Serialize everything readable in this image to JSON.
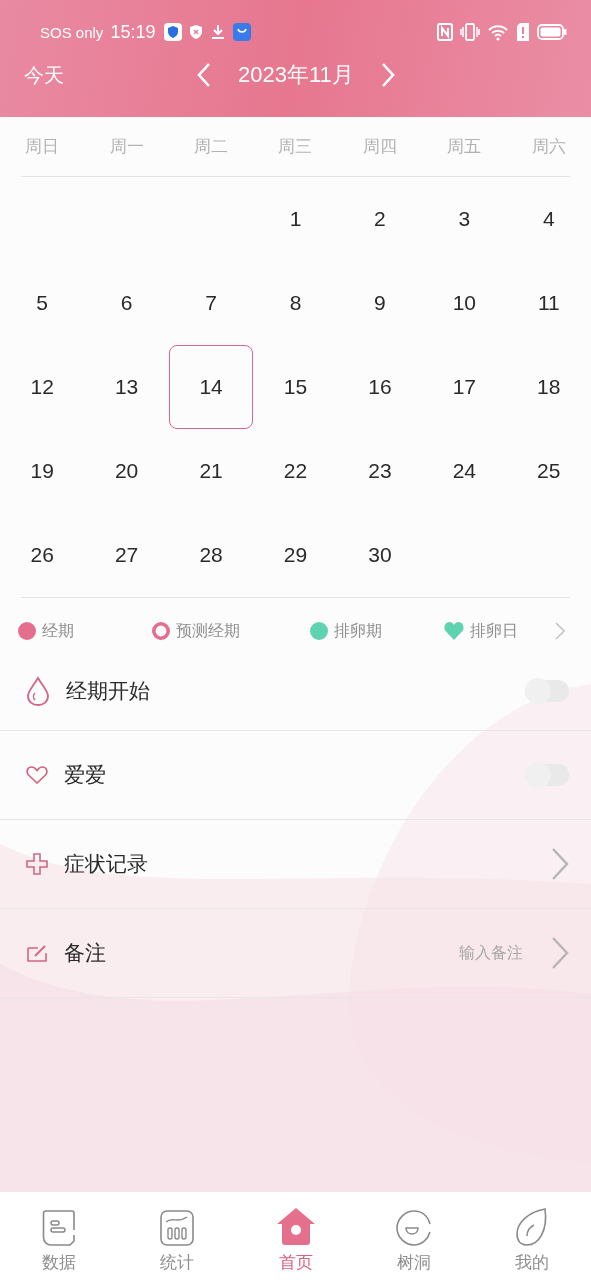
{
  "status_bar": {
    "carrier": "SOS only",
    "time": "15:19"
  },
  "header": {
    "today": "今天",
    "month": "2023年11月"
  },
  "weekdays": [
    "周日",
    "周一",
    "周二",
    "周三",
    "周四",
    "周五",
    "周六"
  ],
  "weeks": [
    [
      {
        "kind": "blank"
      },
      {
        "kind": "blank"
      },
      {
        "kind": "blank"
      },
      {
        "kind": "day",
        "day": "1",
        "selected": false
      },
      {
        "kind": "day",
        "day": "2",
        "selected": false
      },
      {
        "kind": "day",
        "day": "3",
        "selected": false
      },
      {
        "kind": "day",
        "day": "4",
        "selected": false
      }
    ],
    [
      {
        "kind": "day",
        "day": "5",
        "selected": false
      },
      {
        "kind": "day",
        "day": "6",
        "selected": false
      },
      {
        "kind": "day",
        "day": "7",
        "selected": false
      },
      {
        "kind": "day",
        "day": "8",
        "selected": false
      },
      {
        "kind": "day",
        "day": "9",
        "selected": false
      },
      {
        "kind": "day",
        "day": "10",
        "selected": false
      },
      {
        "kind": "day",
        "day": "11",
        "selected": false
      }
    ],
    [
      {
        "kind": "day",
        "day": "12",
        "selected": false
      },
      {
        "kind": "day",
        "day": "13",
        "selected": false
      },
      {
        "kind": "day",
        "day": "14",
        "selected": true
      },
      {
        "kind": "day",
        "day": "15",
        "selected": false
      },
      {
        "kind": "day",
        "day": "16",
        "selected": false
      },
      {
        "kind": "day",
        "day": "17",
        "selected": false
      },
      {
        "kind": "day",
        "day": "18",
        "selected": false
      }
    ],
    [
      {
        "kind": "day",
        "day": "19",
        "selected": false
      },
      {
        "kind": "day",
        "day": "20",
        "selected": false
      },
      {
        "kind": "day",
        "day": "21",
        "selected": false
      },
      {
        "kind": "day",
        "day": "22",
        "selected": false
      },
      {
        "kind": "day",
        "day": "23",
        "selected": false
      },
      {
        "kind": "day",
        "day": "24",
        "selected": false
      },
      {
        "kind": "day",
        "day": "25",
        "selected": false
      }
    ],
    [
      {
        "kind": "day",
        "day": "26",
        "selected": false
      },
      {
        "kind": "day",
        "day": "27",
        "selected": false
      },
      {
        "kind": "day",
        "day": "28",
        "selected": false
      },
      {
        "kind": "day",
        "day": "29",
        "selected": false
      },
      {
        "kind": "day",
        "day": "30",
        "selected": false
      },
      {
        "kind": "blank"
      },
      {
        "kind": "blank"
      }
    ]
  ],
  "legend": [
    {
      "kind": "dot",
      "label": "经期",
      "color": "#e36f8d"
    },
    {
      "kind": "ring",
      "label": "预测经期",
      "color": "#e36f8d"
    },
    {
      "kind": "dot",
      "label": "排卵期",
      "color": "#5fd3b0"
    },
    {
      "kind": "heart",
      "label": "排卵日",
      "color": "#5fd3b0"
    }
  ],
  "records": [
    {
      "kind": "toggle",
      "label": "经期开始",
      "on": false
    },
    {
      "kind": "toggle",
      "label": "爱爱",
      "on": false
    },
    {
      "kind": "link",
      "label": "症状记录"
    },
    {
      "kind": "link",
      "label": "备注",
      "placeholder": "输入备注"
    }
  ],
  "nav": [
    {
      "label": "数据",
      "selected": false
    },
    {
      "label": "统计",
      "selected": false
    },
    {
      "label": "首页",
      "selected": true
    },
    {
      "label": "树洞",
      "selected": false
    },
    {
      "label": "我的",
      "selected": false
    }
  ]
}
